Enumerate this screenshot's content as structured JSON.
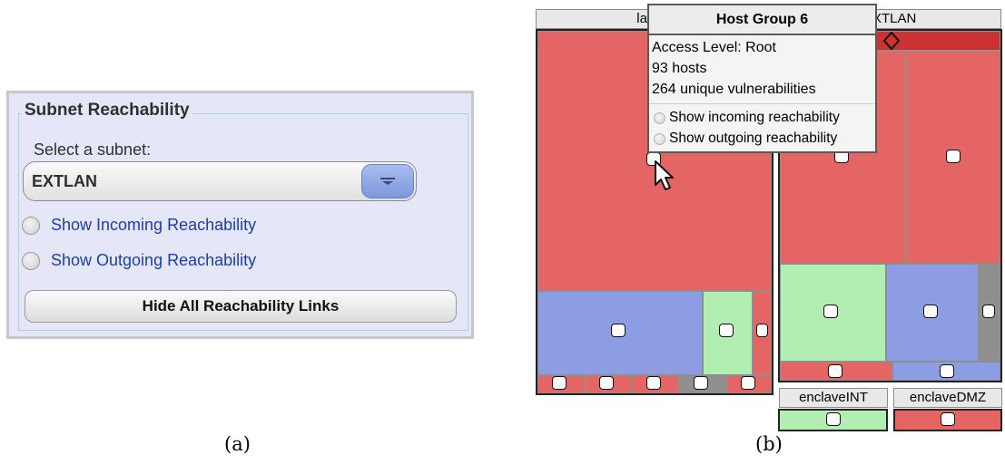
{
  "panel_a": {
    "legend": "Subnet Reachability",
    "select_label": "Select a subnet:",
    "select_value": "EXTLAN",
    "radio_incoming": "Show Incoming Reachability",
    "radio_outgoing": "Show Outgoing Reachability",
    "hide_button": "Hide All Reachability Links",
    "caption": "(a)"
  },
  "panel_b": {
    "header_left": "lans",
    "header_right": "XTLAN",
    "enclave_int": "enclaveINT",
    "enclave_dmz": "enclaveDMZ",
    "caption": "(b)",
    "popup": {
      "title": "Host Group 6",
      "access_level": "Access Level: Root",
      "hosts": "93 hosts",
      "vulns": "264 unique vulnerabilities",
      "incoming": "Show incoming reachability",
      "outgoing": "Show outgoing reachability"
    }
  },
  "colors": {
    "root_red": "#e56464",
    "blue": "#8c9de3",
    "green": "#b2eeb2",
    "gray": "#8f8f8f",
    "link_blue": "#1a3fa8",
    "panel_bg": "#e5e6f8"
  },
  "icons": {
    "dropdown": "triangle-down-icon",
    "cursor": "mouse-pointer-icon",
    "diamond": "diamond-icon"
  }
}
